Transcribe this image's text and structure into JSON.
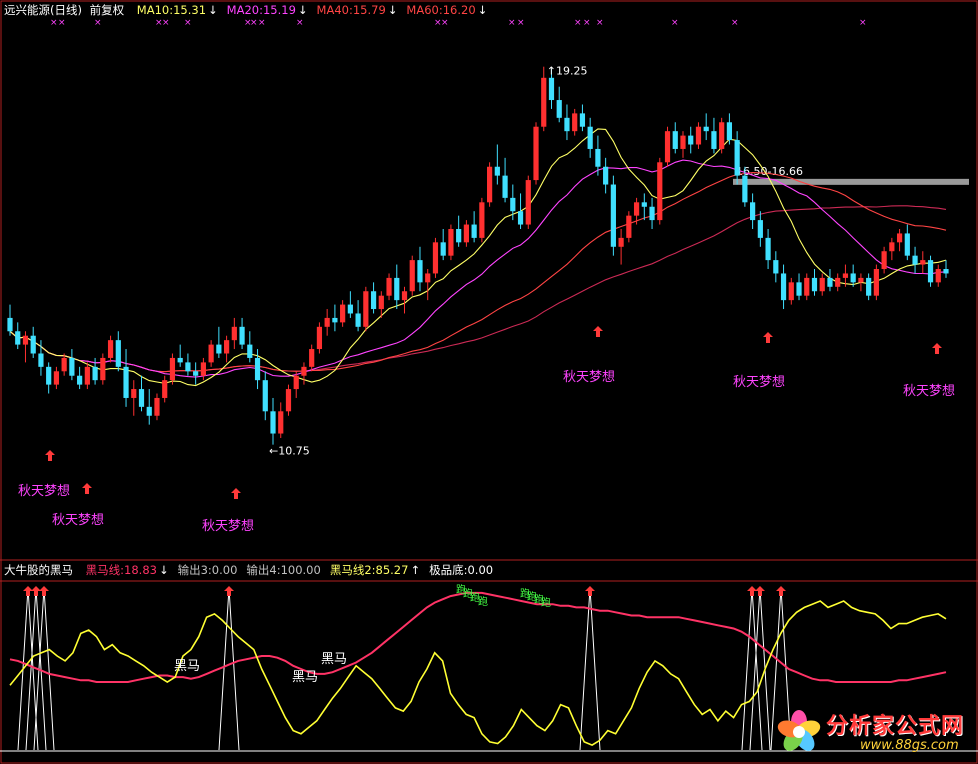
{
  "upper_header": {
    "title": "远兴能源(日线)",
    "adjust": "前复权",
    "ma_items": [
      {
        "label": "MA10:15.31",
        "color": "#ffff66",
        "arrow": "↓"
      },
      {
        "label": "MA20:15.19",
        "color": "#ff44ff",
        "arrow": "↓"
      },
      {
        "label": "MA40:15.79",
        "color": "#ff4444",
        "arrow": "↓"
      },
      {
        "label": "MA60:16.20",
        "color": "#ff4444",
        "arrow": "↓"
      }
    ]
  },
  "lower_header": {
    "title": "大牛股的黑马",
    "items": [
      {
        "label": "黑马线:18.83",
        "color": "#ff3366",
        "arrow": "↓"
      },
      {
        "label": "输出3:0.00",
        "color": "#c0c0c0",
        "arrow": ""
      },
      {
        "label": "输出4:100.00",
        "color": "#c0c0c0",
        "arrow": ""
      },
      {
        "label": "黑马线2:85.27",
        "color": "#ffff66",
        "arrow": "↑"
      },
      {
        "label": "极品底:0.00",
        "color": "#ffffff",
        "arrow": ""
      }
    ]
  },
  "annotations": {
    "high_label": "19.25",
    "low_label": "10.75",
    "zone_label": "16.50-16.66",
    "signal_text": "秋天梦想",
    "lower_text": "黑马",
    "lower_green": "跑"
  },
  "watermark": {
    "name": "分析家公式网",
    "url": "www.88gs.com"
  },
  "colors": {
    "background": "#000000",
    "up": "#ff3030",
    "down": "#40e0ff",
    "ma10": "#ffff66",
    "ma20": "#ff44ff",
    "ma40": "#ff4444",
    "ma60": "#cc2a55",
    "heima": "#ff3366",
    "heima2": "#ffff33",
    "signal_text": "#ff44ff",
    "frame": "#b02020"
  },
  "chart_data": [
    {
      "type": "candlestick",
      "title": "远兴能源(日线)",
      "ylim": [
        10.0,
        20.3
      ],
      "ohlc": [
        [
          13.6,
          13.9,
          13.2,
          13.3
        ],
        [
          13.3,
          13.5,
          12.9,
          13.0
        ],
        [
          13.0,
          13.3,
          12.6,
          13.2
        ],
        [
          13.2,
          13.4,
          12.7,
          12.8
        ],
        [
          12.8,
          13.1,
          12.3,
          12.5
        ],
        [
          12.5,
          12.6,
          11.9,
          12.1
        ],
        [
          12.1,
          12.5,
          12.0,
          12.4
        ],
        [
          12.4,
          12.8,
          12.3,
          12.7
        ],
        [
          12.7,
          12.9,
          12.2,
          12.3
        ],
        [
          12.3,
          12.5,
          12.0,
          12.1
        ],
        [
          12.1,
          12.6,
          12.0,
          12.5
        ],
        [
          12.5,
          12.7,
          12.1,
          12.2
        ],
        [
          12.2,
          12.8,
          12.1,
          12.7
        ],
        [
          12.7,
          13.2,
          12.6,
          13.1
        ],
        [
          13.1,
          13.3,
          12.4,
          12.5
        ],
        [
          12.5,
          12.9,
          11.6,
          11.8
        ],
        [
          11.8,
          12.2,
          11.4,
          12.0
        ],
        [
          12.0,
          12.3,
          11.5,
          11.6
        ],
        [
          11.6,
          12.0,
          11.2,
          11.4
        ],
        [
          11.4,
          11.9,
          11.3,
          11.8
        ],
        [
          11.8,
          12.3,
          11.7,
          12.2
        ],
        [
          12.2,
          12.8,
          12.1,
          12.7
        ],
        [
          12.7,
          13.0,
          12.5,
          12.6
        ],
        [
          12.6,
          12.8,
          12.3,
          12.4
        ],
        [
          12.4,
          12.6,
          12.1,
          12.3
        ],
        [
          12.3,
          12.7,
          12.2,
          12.6
        ],
        [
          12.6,
          13.1,
          12.5,
          13.0
        ],
        [
          13.0,
          13.4,
          12.7,
          12.8
        ],
        [
          12.8,
          13.2,
          12.6,
          13.1
        ],
        [
          13.1,
          13.6,
          12.9,
          13.4
        ],
        [
          13.4,
          13.6,
          12.9,
          13.0
        ],
        [
          13.0,
          13.3,
          12.6,
          12.7
        ],
        [
          12.7,
          12.9,
          12.0,
          12.2
        ],
        [
          12.2,
          12.4,
          11.3,
          11.5
        ],
        [
          11.5,
          11.8,
          10.75,
          11.0
        ],
        [
          11.0,
          11.7,
          10.9,
          11.5
        ],
        [
          11.5,
          12.1,
          11.4,
          12.0
        ],
        [
          12.0,
          12.4,
          11.8,
          12.3
        ],
        [
          12.3,
          12.6,
          12.1,
          12.5
        ],
        [
          12.5,
          13.0,
          12.4,
          12.9
        ],
        [
          12.9,
          13.5,
          12.8,
          13.4
        ],
        [
          13.4,
          13.8,
          13.2,
          13.6
        ],
        [
          13.6,
          13.9,
          13.3,
          13.5
        ],
        [
          13.5,
          14.0,
          13.4,
          13.9
        ],
        [
          13.9,
          14.2,
          13.6,
          13.7
        ],
        [
          13.7,
          14.0,
          13.3,
          13.4
        ],
        [
          13.4,
          14.3,
          13.3,
          14.2
        ],
        [
          14.2,
          14.4,
          13.7,
          13.8
        ],
        [
          13.8,
          14.2,
          13.6,
          14.1
        ],
        [
          14.1,
          14.6,
          14.0,
          14.5
        ],
        [
          14.5,
          14.8,
          13.8,
          14.0
        ],
        [
          14.0,
          14.3,
          13.7,
          14.2
        ],
        [
          14.2,
          15.0,
          14.1,
          14.9
        ],
        [
          14.9,
          15.2,
          14.2,
          14.4
        ],
        [
          14.4,
          14.7,
          14.0,
          14.6
        ],
        [
          14.6,
          15.4,
          14.5,
          15.3
        ],
        [
          15.3,
          15.6,
          14.9,
          15.0
        ],
        [
          15.0,
          15.7,
          14.9,
          15.6
        ],
        [
          15.6,
          15.9,
          15.2,
          15.3
        ],
        [
          15.3,
          15.8,
          15.2,
          15.7
        ],
        [
          15.7,
          16.0,
          15.3,
          15.4
        ],
        [
          15.4,
          16.3,
          15.3,
          16.2
        ],
        [
          16.2,
          17.1,
          16.1,
          17.0
        ],
        [
          17.0,
          17.5,
          16.6,
          16.8
        ],
        [
          16.8,
          17.2,
          16.2,
          16.3
        ],
        [
          16.3,
          16.6,
          15.8,
          16.0
        ],
        [
          16.0,
          16.4,
          15.6,
          15.7
        ],
        [
          15.7,
          16.8,
          15.6,
          16.7
        ],
        [
          16.7,
          18.0,
          16.6,
          17.9
        ],
        [
          17.9,
          19.25,
          17.8,
          19.0
        ],
        [
          19.0,
          19.2,
          18.3,
          18.5
        ],
        [
          18.5,
          18.8,
          18.0,
          18.1
        ],
        [
          18.1,
          18.4,
          17.6,
          17.8
        ],
        [
          17.8,
          18.3,
          17.7,
          18.2
        ],
        [
          18.2,
          18.4,
          17.8,
          17.9
        ],
        [
          17.9,
          18.1,
          17.2,
          17.4
        ],
        [
          17.4,
          17.7,
          16.8,
          17.0
        ],
        [
          17.0,
          17.2,
          16.4,
          16.6
        ],
        [
          16.6,
          16.8,
          15.0,
          15.2
        ],
        [
          15.2,
          15.6,
          14.8,
          15.4
        ],
        [
          15.4,
          16.0,
          15.3,
          15.9
        ],
        [
          15.9,
          16.3,
          15.7,
          16.2
        ],
        [
          16.2,
          16.4,
          15.8,
          16.1
        ],
        [
          16.1,
          16.3,
          15.6,
          15.8
        ],
        [
          15.8,
          17.2,
          15.7,
          17.1
        ],
        [
          17.1,
          17.9,
          17.0,
          17.8
        ],
        [
          17.8,
          18.0,
          17.3,
          17.4
        ],
        [
          17.4,
          17.8,
          17.2,
          17.7
        ],
        [
          17.7,
          17.9,
          17.3,
          17.5
        ],
        [
          17.5,
          18.0,
          17.4,
          17.9
        ],
        [
          17.9,
          18.2,
          17.6,
          17.8
        ],
        [
          17.8,
          18.1,
          17.3,
          17.4
        ],
        [
          17.4,
          18.1,
          17.3,
          18.0
        ],
        [
          18.0,
          18.2,
          17.5,
          17.6
        ],
        [
          17.6,
          17.8,
          16.6,
          16.8
        ],
        [
          16.8,
          17.0,
          16.1,
          16.2
        ],
        [
          16.2,
          16.4,
          15.6,
          15.8
        ],
        [
          15.8,
          16.0,
          15.2,
          15.4
        ],
        [
          15.4,
          15.6,
          14.7,
          14.9
        ],
        [
          14.9,
          15.1,
          14.4,
          14.6
        ],
        [
          14.6,
          14.8,
          13.8,
          14.0
        ],
        [
          14.0,
          14.5,
          13.9,
          14.4
        ],
        [
          14.4,
          14.6,
          14.0,
          14.1
        ],
        [
          14.1,
          14.6,
          14.0,
          14.5
        ],
        [
          14.5,
          14.7,
          14.1,
          14.2
        ],
        [
          14.2,
          14.6,
          14.1,
          14.5
        ],
        [
          14.5,
          14.7,
          14.2,
          14.3
        ],
        [
          14.3,
          14.6,
          14.2,
          14.5
        ],
        [
          14.5,
          14.8,
          14.3,
          14.6
        ],
        [
          14.6,
          14.8,
          14.3,
          14.4
        ],
        [
          14.4,
          14.6,
          14.2,
          14.5
        ],
        [
          14.5,
          14.6,
          14.0,
          14.1
        ],
        [
          14.1,
          14.8,
          14.0,
          14.7
        ],
        [
          14.7,
          15.2,
          14.6,
          15.1
        ],
        [
          15.1,
          15.4,
          14.9,
          15.3
        ],
        [
          15.3,
          15.6,
          15.1,
          15.5
        ],
        [
          15.5,
          15.7,
          14.9,
          15.0
        ],
        [
          15.0,
          15.2,
          14.6,
          14.8
        ],
        [
          14.8,
          15.1,
          14.6,
          14.9
        ],
        [
          14.9,
          15.0,
          14.3,
          14.4
        ],
        [
          14.4,
          14.8,
          14.3,
          14.7
        ],
        [
          14.7,
          14.9,
          14.5,
          14.6
        ]
      ]
    },
    {
      "type": "line",
      "title": "大牛股的黑马",
      "ylim": [
        0,
        100
      ],
      "series": [
        {
          "name": "黑马线",
          "values": [
            56,
            55,
            53,
            51,
            49,
            47,
            46,
            45,
            44,
            43,
            43,
            42,
            42,
            42,
            42,
            42,
            43,
            44,
            45,
            46,
            46,
            45,
            45,
            44,
            45,
            47,
            49,
            51,
            53,
            55,
            56,
            57,
            58,
            58,
            57,
            55,
            52,
            50,
            48,
            47,
            47,
            48,
            50,
            52,
            54,
            57,
            60,
            64,
            68,
            72,
            76,
            80,
            84,
            88,
            91,
            93,
            95,
            96,
            97,
            97,
            97,
            96,
            95,
            94,
            93,
            92,
            91,
            90,
            90,
            90,
            89,
            89,
            88,
            88,
            87,
            86,
            86,
            85,
            84,
            83,
            83,
            82,
            82,
            82,
            82,
            82,
            81,
            80,
            79,
            78,
            77,
            76,
            75,
            73,
            70,
            66,
            62,
            58,
            54,
            50,
            48,
            46,
            44,
            43,
            43,
            42,
            42,
            42,
            42,
            42,
            42,
            42,
            42,
            43,
            43,
            44,
            45,
            46,
            47,
            48
          ]
        },
        {
          "name": "黑马线2",
          "values": [
            40,
            46,
            52,
            58,
            60,
            62,
            58,
            55,
            60,
            72,
            74,
            70,
            62,
            65,
            60,
            58,
            55,
            52,
            48,
            45,
            42,
            45,
            58,
            62,
            70,
            82,
            84,
            80,
            75,
            70,
            66,
            62,
            50,
            40,
            30,
            20,
            12,
            10,
            14,
            18,
            25,
            32,
            38,
            45,
            52,
            48,
            44,
            38,
            32,
            26,
            24,
            30,
            42,
            50,
            60,
            55,
            35,
            28,
            22,
            20,
            10,
            5,
            4,
            8,
            15,
            25,
            20,
            15,
            12,
            18,
            28,
            26,
            15,
            5,
            3,
            6,
            12,
            10,
            18,
            26,
            38,
            48,
            55,
            52,
            47,
            44,
            36,
            28,
            22,
            25,
            18,
            24,
            20,
            28,
            30,
            36,
            50,
            62,
            72,
            80,
            85,
            88,
            90,
            92,
            88,
            90,
            92,
            88,
            86,
            85,
            84,
            80,
            75,
            78,
            78,
            80,
            82,
            83,
            84,
            81
          ]
        },
        {
          "name": "输出4",
          "values": [
            0,
            100,
            100,
            100,
            0,
            0,
            0,
            0,
            0,
            0,
            0,
            0,
            0,
            0,
            0,
            0,
            0,
            0,
            0,
            0,
            0,
            0,
            0,
            0,
            0,
            0,
            0,
            0,
            0,
            0,
            0,
            0,
            0,
            0,
            100,
            0,
            0,
            0,
            0,
            0,
            0,
            0,
            0,
            0,
            0,
            0,
            0,
            0,
            0,
            0,
            0,
            0,
            0,
            0,
            0,
            0,
            0,
            0,
            0,
            0,
            0,
            0,
            0,
            0,
            0,
            0,
            0,
            0,
            0,
            0,
            0,
            0,
            0,
            0,
            0,
            0,
            0,
            0,
            0,
            100,
            0,
            0,
            0,
            0,
            0,
            0,
            0,
            0,
            0,
            0,
            0,
            0,
            0,
            0,
            0,
            0,
            0,
            0,
            0,
            0,
            0,
            0,
            0,
            0,
            0,
            0,
            0,
            0,
            0,
            0,
            0,
            0,
            0,
            0,
            0,
            0,
            0,
            0,
            0,
            0
          ]
        }
      ]
    }
  ]
}
